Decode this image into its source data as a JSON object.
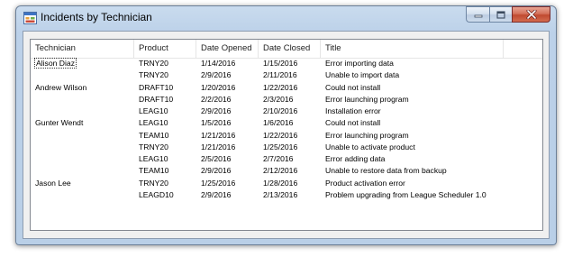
{
  "window": {
    "title": "Incidents by Technician",
    "icon": "form-app-icon"
  },
  "caption_buttons": {
    "minimize": "minimize-icon",
    "maximize": "maximize-icon",
    "close": "close-icon"
  },
  "listview": {
    "columns": [
      "Technician",
      "Product",
      "Date Opened",
      "Date Closed",
      "Title"
    ],
    "rows": [
      [
        "Alison Diaz",
        "TRNY20",
        "1/14/2016",
        "1/15/2016",
        "Error importing data"
      ],
      [
        "",
        "TRNY20",
        "2/9/2016",
        "2/11/2016",
        "Unable to import data"
      ],
      [
        "Andrew Wilson",
        "DRAFT10",
        "1/20/2016",
        "1/22/2016",
        "Could not install"
      ],
      [
        "",
        "DRAFT10",
        "2/2/2016",
        "2/3/2016",
        "Error launching program"
      ],
      [
        "",
        "LEAG10",
        "2/9/2016",
        "2/10/2016",
        "Installation error"
      ],
      [
        "Gunter Wendt",
        "LEAG10",
        "1/5/2016",
        "1/6/2016",
        "Could not install"
      ],
      [
        "",
        "TEAM10",
        "1/21/2016",
        "1/22/2016",
        "Error launching program"
      ],
      [
        "",
        "TRNY20",
        "1/21/2016",
        "1/25/2016",
        "Unable to activate product"
      ],
      [
        "",
        "LEAG10",
        "2/5/2016",
        "2/7/2016",
        "Error adding data"
      ],
      [
        "",
        "TEAM10",
        "2/9/2016",
        "2/12/2016",
        "Unable to restore data from backup"
      ],
      [
        "Jason Lee",
        "TRNY20",
        "1/25/2016",
        "1/28/2016",
        "Product activation error"
      ],
      [
        "",
        "LEAGD10",
        "2/9/2016",
        "2/13/2016",
        "Problem upgrading from League Scheduler 1.0"
      ]
    ],
    "focused_row": 0
  }
}
